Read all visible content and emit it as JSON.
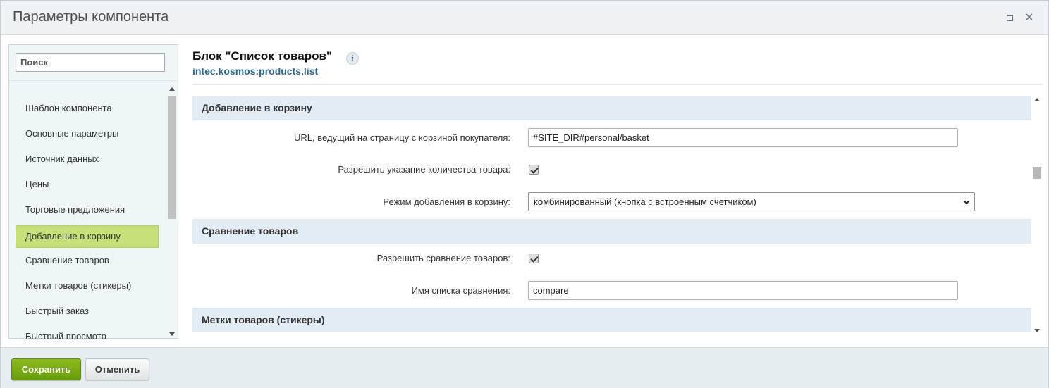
{
  "window": {
    "title": "Параметры компонента"
  },
  "sidebar": {
    "search_placeholder": "Поиск",
    "items": [
      {
        "label": "Шаблон компонента"
      },
      {
        "label": "Основные параметры"
      },
      {
        "label": "Источник данных"
      },
      {
        "label": "Цены"
      },
      {
        "label": "Торговые предложения"
      },
      {
        "label": "Добавление в корзину",
        "active": true
      },
      {
        "label": "Сравнение товаров"
      },
      {
        "label": "Метки товаров (стикеры)"
      },
      {
        "label": "Быстрый заказ"
      },
      {
        "label": "Быстрый просмотр"
      }
    ]
  },
  "main": {
    "heading": "Блок \"Список товаров\"",
    "info_icon_glyph": "i",
    "component_id": "intec.kosmos:products.list",
    "sections": [
      {
        "title": "Добавление в корзину",
        "fields": [
          {
            "label": "URL, ведущий на страницу с корзиной покупателя:",
            "type": "text",
            "value": "#SITE_DIR#personal/basket"
          },
          {
            "label": "Разрешить указание количества товара:",
            "type": "checkbox",
            "checked": true
          },
          {
            "label": "Режим добавления в корзину:",
            "type": "select",
            "value": "комбинированный (кнопка с встроенным счетчиком)"
          }
        ]
      },
      {
        "title": "Сравнение товаров",
        "fields": [
          {
            "label": "Разрешить сравнение товаров:",
            "type": "checkbox",
            "checked": true
          },
          {
            "label": "Имя списка сравнения:",
            "type": "text",
            "value": "compare"
          }
        ]
      },
      {
        "title": "Метки товаров (стикеры)",
        "fields": []
      }
    ]
  },
  "footer": {
    "save_label": "Сохранить",
    "cancel_label": "Отменить"
  },
  "colors": {
    "active_nav": "#c8e07a",
    "section_header": "#e1ecf5",
    "link_blue": "#2b6893",
    "save_button": "#78ad14"
  }
}
